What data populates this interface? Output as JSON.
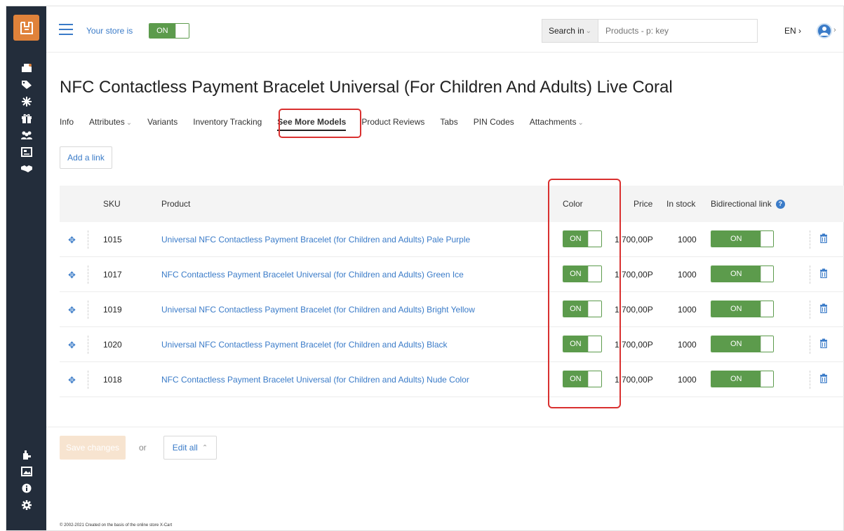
{
  "topbar": {
    "store_label": "Your store is",
    "store_toggle": "ON",
    "search_button": "Search in",
    "search_placeholder": "Products - p: key",
    "language": "EN"
  },
  "page": {
    "title": "NFC Contactless Payment Bracelet Universal (For Children And Adults) Live Coral"
  },
  "tabs": [
    {
      "label": "Info",
      "dropdown": false
    },
    {
      "label": "Attributes",
      "dropdown": true
    },
    {
      "label": "Variants",
      "dropdown": false
    },
    {
      "label": "Inventory Tracking",
      "dropdown": false
    },
    {
      "label": "See More Models",
      "dropdown": false,
      "active": true
    },
    {
      "label": "Product Reviews",
      "dropdown": false
    },
    {
      "label": "Tabs",
      "dropdown": false
    },
    {
      "label": "PIN Codes",
      "dropdown": false
    },
    {
      "label": "Attachments",
      "dropdown": true
    }
  ],
  "add_link_label": "Add a link",
  "table": {
    "headers": {
      "sku": "SKU",
      "product": "Product",
      "color": "Color",
      "price": "Price",
      "stock": "In stock",
      "bidirectional": "Bidirectional link"
    },
    "rows": [
      {
        "sku": "1015",
        "product": "Universal NFC Contactless Payment Bracelet (for Children and Adults) Pale Purple",
        "color": "ON",
        "price": "1 700,00P",
        "stock": "1000",
        "bidirectional": "ON"
      },
      {
        "sku": "1017",
        "product": "NFC Contactless Payment Bracelet Universal (for Children and Adults) Green Ice",
        "color": "ON",
        "price": "1 700,00P",
        "stock": "1000",
        "bidirectional": "ON"
      },
      {
        "sku": "1019",
        "product": "Universal NFC Contactless Payment Bracelet (for Children and Adults) Bright Yellow",
        "color": "ON",
        "price": "1 700,00P",
        "stock": "1000",
        "bidirectional": "ON"
      },
      {
        "sku": "1020",
        "product": "Universal NFC Contactless Payment Bracelet (for Children and Adults) Black",
        "color": "ON",
        "price": "1 700,00P",
        "stock": "1000",
        "bidirectional": "ON"
      },
      {
        "sku": "1018",
        "product": "NFC Contactless Payment Bracelet Universal (for Children and Adults) Nude Color",
        "color": "ON",
        "price": "1 700,00P",
        "stock": "1000",
        "bidirectional": "ON"
      }
    ]
  },
  "actions": {
    "save_label": "Save changes",
    "or_label": "or",
    "edit_all_label": "Edit all"
  },
  "footer": "© 2002-2021 Created on the basis of the online store X-Cart",
  "colors": {
    "sidebar": "#232d3b",
    "accent_orange": "#e0823a",
    "toggle_green": "#5c9b4c",
    "link_blue": "#3a7bc8",
    "highlight_red": "#d9302f"
  }
}
